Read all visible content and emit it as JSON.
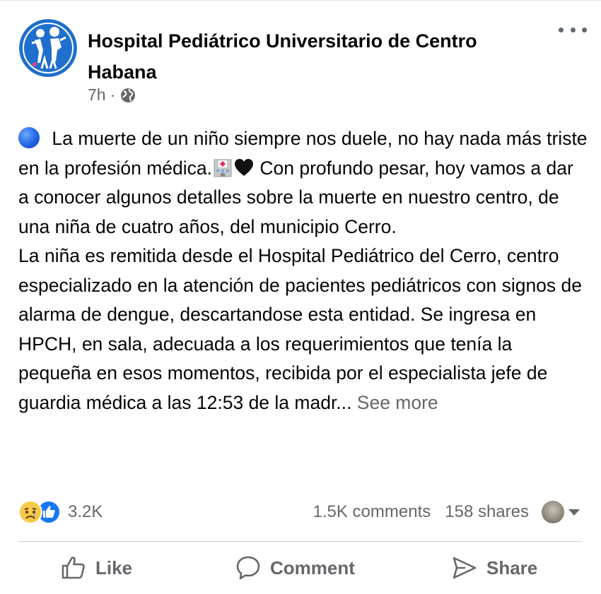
{
  "page": {
    "name": "Hospital Pediátrico Universitario de Centro Habana",
    "time": "7h",
    "separator": "·",
    "audience_icon": "globe-icon"
  },
  "post": {
    "line1": " La muerte de un niño siempre nos duele, no hay nada más triste en la profesión médica.",
    "line2": " Con profundo pesar, hoy vamos a dar a conocer algunos detalles sobre la muerte en nuestro centro, de una niña de cuatro años, del municipio Cerro.",
    "paragraph2": "La niña es remitida desde el Hospital Pediátrico del Cerro, centro especializado en la atención de pacientes pediátricos con signos de alarma de dengue, descartandose esta entidad. Se ingresa en HPCH, en sala, adecuada a los requerimientos que tenía la pequeña en esos momentos, recibida por el especialista jefe de guardia médica a las 12:53 de la madr...",
    "see_more": "See more",
    "emojis": [
      "blue-circle",
      "hospital",
      "black-heart"
    ]
  },
  "engagement": {
    "reaction_icons": [
      "sad-reaction-icon",
      "like-reaction-icon"
    ],
    "reaction_count": "3.2K",
    "comments": "1.5K comments",
    "shares": "158 shares"
  },
  "actions": {
    "like": "Like",
    "comment": "Comment",
    "share": "Share"
  },
  "colors": {
    "text": "#050505",
    "secondary": "#65676b",
    "like_blue": "#1877f2",
    "brand_blue": "#1f6fcc"
  }
}
